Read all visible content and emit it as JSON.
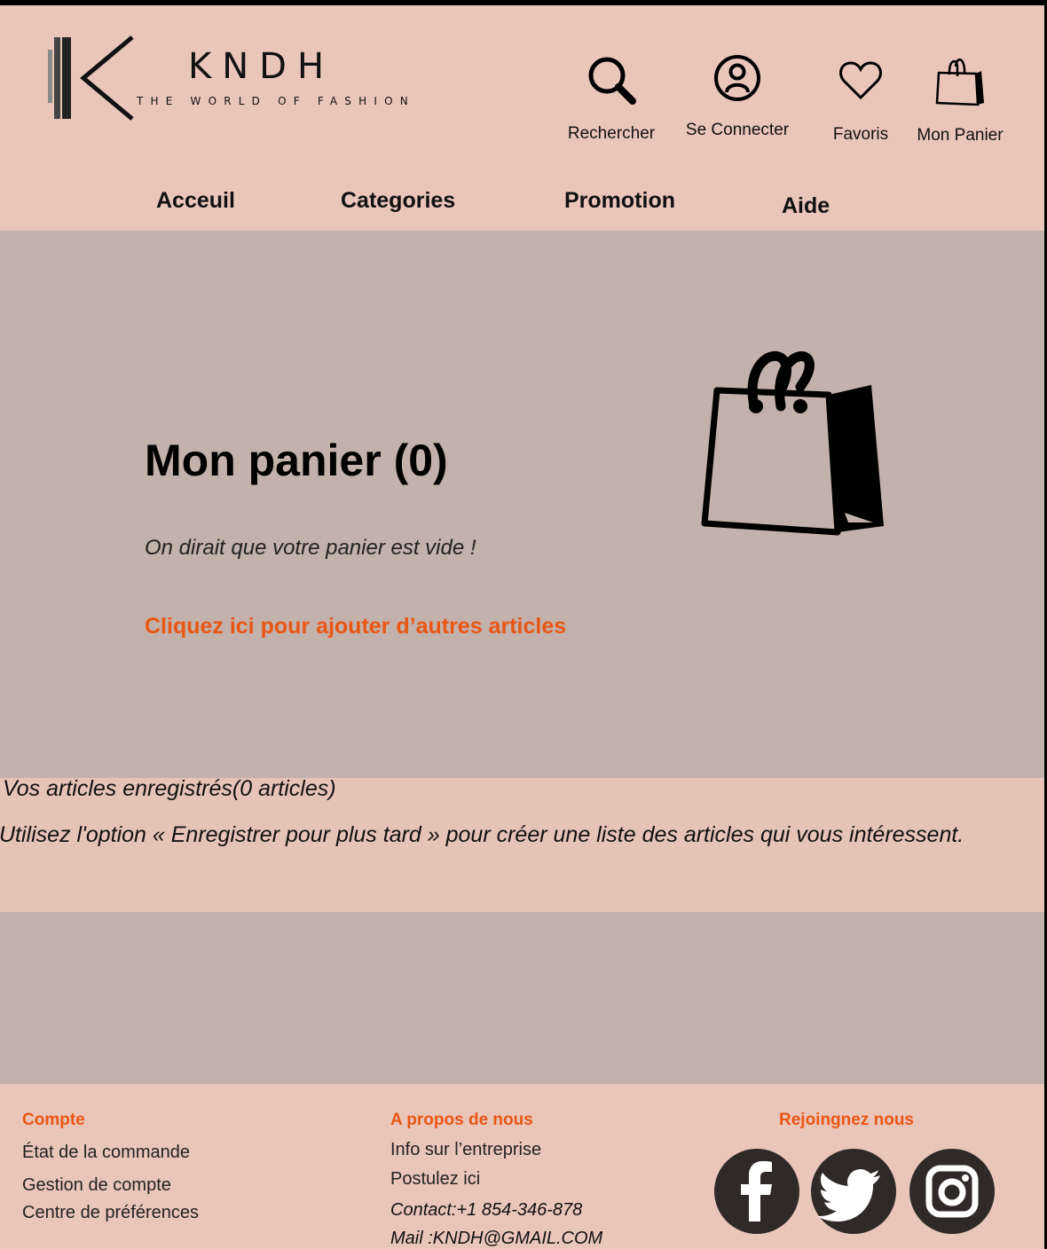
{
  "brand": {
    "name": "KNDH",
    "tagline": "THE WORLD OF FASHION"
  },
  "header_icons": {
    "search": "Rechercher",
    "login": "Se Connecter",
    "favorites": "Favoris",
    "cart": "Mon Panier"
  },
  "nav": {
    "home": "Acceuil",
    "categories": "Categories",
    "promotion": "Promotion",
    "help": "Aide"
  },
  "cart": {
    "title": "Mon panier (0)",
    "empty_message": "On dirait que votre panier est vide !",
    "add_link": "Cliquez ici pour ajouter d’autres articles"
  },
  "saved": {
    "title": "Vos articles enregistrés(0 articles)",
    "description": "Utilisez l'option « Enregistrer pour plus tard » pour créer une liste des articles qui vous intéressent."
  },
  "footer": {
    "account": {
      "heading": "Compte",
      "links": [
        "État de la commande",
        "Gestion de compte",
        "Centre de préférences"
      ]
    },
    "about": {
      "heading": "A propos de nous",
      "links": [
        "Info sur l’entreprise",
        "Postulez ici"
      ],
      "contact": "Contact:+1 854-346-878",
      "mail": "Mail :KNDH@GMAIL.COM"
    },
    "social": {
      "heading": "Rejoingnez nous",
      "icons": [
        "facebook-icon",
        "twitter-icon",
        "instagram-icon"
      ]
    }
  },
  "colors": {
    "accent": "#E95614",
    "header_bg": "#EAC6BA",
    "main_bg": "#C3B1AB",
    "saved_bg": "#E6C3B7",
    "social_bg": "#2F2A28"
  }
}
